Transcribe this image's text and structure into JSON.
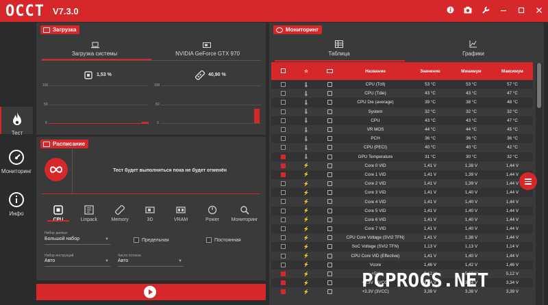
{
  "app": {
    "logo": "OCCT",
    "version": "V7.3.0"
  },
  "sidebar": [
    {
      "label": "Тест",
      "icon": "flame-icon",
      "active": true
    },
    {
      "label": "Мониторинг",
      "icon": "gauge-icon",
      "active": false
    },
    {
      "label": "Инфо",
      "icon": "info-icon",
      "active": false
    }
  ],
  "load_panel": {
    "title": "Загрузка",
    "tabs": [
      "Загрузка системы",
      "NVIDIA GeForce GTX 970"
    ],
    "cpu_load": "1,53 %",
    "gpu_load": "40,90 %",
    "y_ticks": [
      "100",
      "50",
      "0"
    ]
  },
  "schedule_panel": {
    "title": "Расписание",
    "message": "Тест будет выполняться пока не будет отменён",
    "tests": [
      "CPU",
      "Linpack",
      "Memory",
      "3D",
      "VRAM",
      "Power",
      "Мониторинг"
    ],
    "dataset_label": "Набор данных",
    "dataset_value": "Большой набор",
    "extreme_label": "Предельная",
    "constant_label": "Постоянная",
    "instr_label": "Набор инструкций",
    "instr_value": "Авто",
    "threads_label": "Число потоков",
    "threads_value": "Авто"
  },
  "monitor_panel": {
    "title": "Мониторинг",
    "tabs": [
      "Таблица",
      "Графики"
    ],
    "columns": [
      "Название",
      "Значение",
      "Минимум",
      "Максимум"
    ],
    "rows": [
      {
        "checked": false,
        "name": "CPU (Tctl)",
        "value": "53 °C",
        "min": "53 °C",
        "max": "57 °C"
      },
      {
        "checked": false,
        "name": "CPU (Tdie)",
        "value": "43 °C",
        "min": "43 °C",
        "max": "47 °C"
      },
      {
        "checked": false,
        "name": "CPU Die (average)",
        "value": "39 °C",
        "min": "38 °C",
        "max": "48 °C"
      },
      {
        "checked": false,
        "name": "System",
        "value": "32 °C",
        "min": "32 °C",
        "max": "32 °C"
      },
      {
        "checked": false,
        "name": "CPU",
        "value": "43 °C",
        "min": "43 °C",
        "max": "47 °C"
      },
      {
        "checked": false,
        "name": "VR MOS",
        "value": "44 °C",
        "min": "44 °C",
        "max": "45 °C"
      },
      {
        "checked": false,
        "name": "PCH",
        "value": "36 °C",
        "min": "36 °C",
        "max": "36 °C"
      },
      {
        "checked": false,
        "name": "CPU (PECI)",
        "value": "40 °C",
        "min": "40 °C",
        "max": "42 °C"
      },
      {
        "checked": true,
        "name": "GPU Temperature",
        "value": "31 °C",
        "min": "30 °C",
        "max": "32 °C"
      },
      {
        "checked": true,
        "name": "Core 0 VID",
        "value": "1,41 V",
        "min": "1,38 V",
        "max": "1,44 V"
      },
      {
        "checked": true,
        "name": "Core 1 VID",
        "value": "1,41 V",
        "min": "1,39 V",
        "max": "1,44 V"
      },
      {
        "checked": false,
        "name": "Core 2 VID",
        "value": "1,41 V",
        "min": "1,39 V",
        "max": "1,44 V"
      },
      {
        "checked": false,
        "name": "Core 3 VID",
        "value": "1,41 V",
        "min": "1,40 V",
        "max": "1,44 V"
      },
      {
        "checked": false,
        "name": "Core 4 VID",
        "value": "1,41 V",
        "min": "1,40 V",
        "max": "1,44 V"
      },
      {
        "checked": false,
        "name": "Core 5 VID",
        "value": "1,41 V",
        "min": "1,40 V",
        "max": "1,44 V"
      },
      {
        "checked": false,
        "name": "Core 6 VID",
        "value": "1,41 V",
        "min": "1,40 V",
        "max": "1,44 V"
      },
      {
        "checked": false,
        "name": "Core 7 VID",
        "value": "1,41 V",
        "min": "1,40 V",
        "max": "1,44 V"
      },
      {
        "checked": false,
        "name": "CPU Core Voltage (SVI2 TFN)",
        "value": "1,41 V",
        "min": "1,38 V",
        "max": "1,44 V"
      },
      {
        "checked": false,
        "name": "SoC Voltage (SVI2 TFN)",
        "value": "1,13 V",
        "min": "1,13 V",
        "max": "1,14 V"
      },
      {
        "checked": false,
        "name": "CPU Core VID (Effective)",
        "value": "1,41 V",
        "min": "1,40 V",
        "max": "1,44 V"
      },
      {
        "checked": false,
        "name": "Vcore",
        "value": "1,46 V",
        "min": "1,42 V",
        "max": "1,46 V"
      },
      {
        "checked": true,
        "name": "+5V",
        "value": "5,12 V",
        "min": "5,12 V",
        "max": "5,12 V"
      },
      {
        "checked": true,
        "name": "+3.3V (AVCC)",
        "value": "3,34 V",
        "min": "3,34 V",
        "max": "3,34 V"
      },
      {
        "checked": true,
        "name": "+3.3V (3VCC)",
        "value": "3,39 V",
        "min": "3,38 V",
        "max": "3,39 V"
      }
    ]
  },
  "watermark": "PCPROGS.NET",
  "colors": {
    "accent": "#d6272b",
    "panel": "#3a3a3a",
    "background": "#2b2b2b"
  }
}
